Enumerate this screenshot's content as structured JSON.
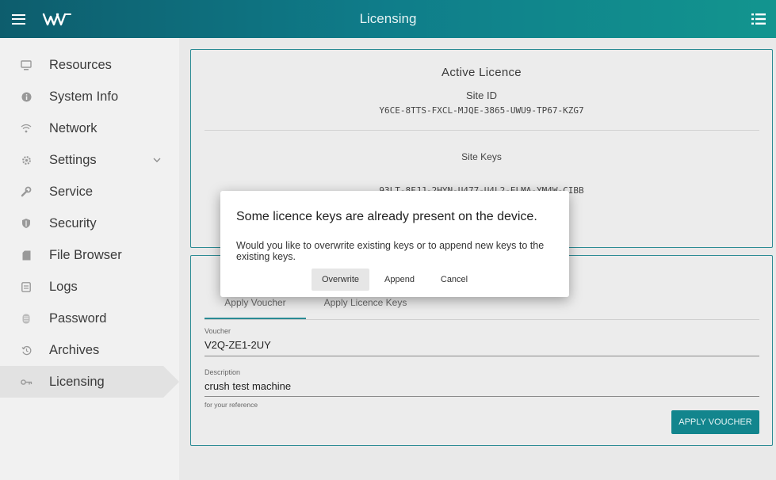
{
  "header": {
    "title": "Licensing",
    "menu_icon": "hamburger-menu-icon",
    "logo_icon": "wv-logo",
    "list_icon": "list-icon"
  },
  "sidebar": {
    "items": [
      {
        "label": "Resources",
        "icon": "monitor-icon"
      },
      {
        "label": "System Info",
        "icon": "info-icon"
      },
      {
        "label": "Network",
        "icon": "wifi-icon"
      },
      {
        "label": "Settings",
        "icon": "gear-icon"
      },
      {
        "label": "Service",
        "icon": "wrench-icon"
      },
      {
        "label": "Security",
        "icon": "shield-icon"
      },
      {
        "label": "File Browser",
        "icon": "file-icon"
      },
      {
        "label": "Logs",
        "icon": "logs-icon"
      },
      {
        "label": "Password",
        "icon": "password-icon"
      },
      {
        "label": "Archives",
        "icon": "history-icon"
      },
      {
        "label": "Licensing",
        "icon": "key-icon"
      }
    ],
    "active": "Licensing"
  },
  "active_licence": {
    "title": "Active Licence",
    "site_id_label": "Site ID",
    "site_id": "Y6CE-8TTS-FXCL-MJQE-3865-UWU9-TP67-KZG7",
    "site_keys_label": "Site Keys",
    "site_key_1": "93LT-8FJJ-2HYN-U477-U4L2-ELMA-YM4W-CIBB"
  },
  "apply": {
    "tabs": [
      "Apply Voucher",
      "Apply Licence Keys"
    ],
    "active_tab": "Apply Voucher",
    "voucher_label": "Voucher",
    "voucher_value": "V2Q-ZE1-2UY",
    "description_label": "Description",
    "description_value": "crush test machine",
    "description_hint": "for your reference",
    "apply_button": "APPLY VOUCHER"
  },
  "dialog": {
    "title": "Some licence keys are already present on the device.",
    "body": "Would you like to overwrite existing keys or to append new keys to the existing keys.",
    "buttons": {
      "overwrite": "Overwrite",
      "append": "Append",
      "cancel": "Cancel"
    }
  },
  "colors": {
    "header_start": "#0d5d6d",
    "header_end": "#12958f",
    "accent": "#12858d",
    "sidebar_bg": "#f1f1f1",
    "main_bg": "#e9e9e9"
  }
}
